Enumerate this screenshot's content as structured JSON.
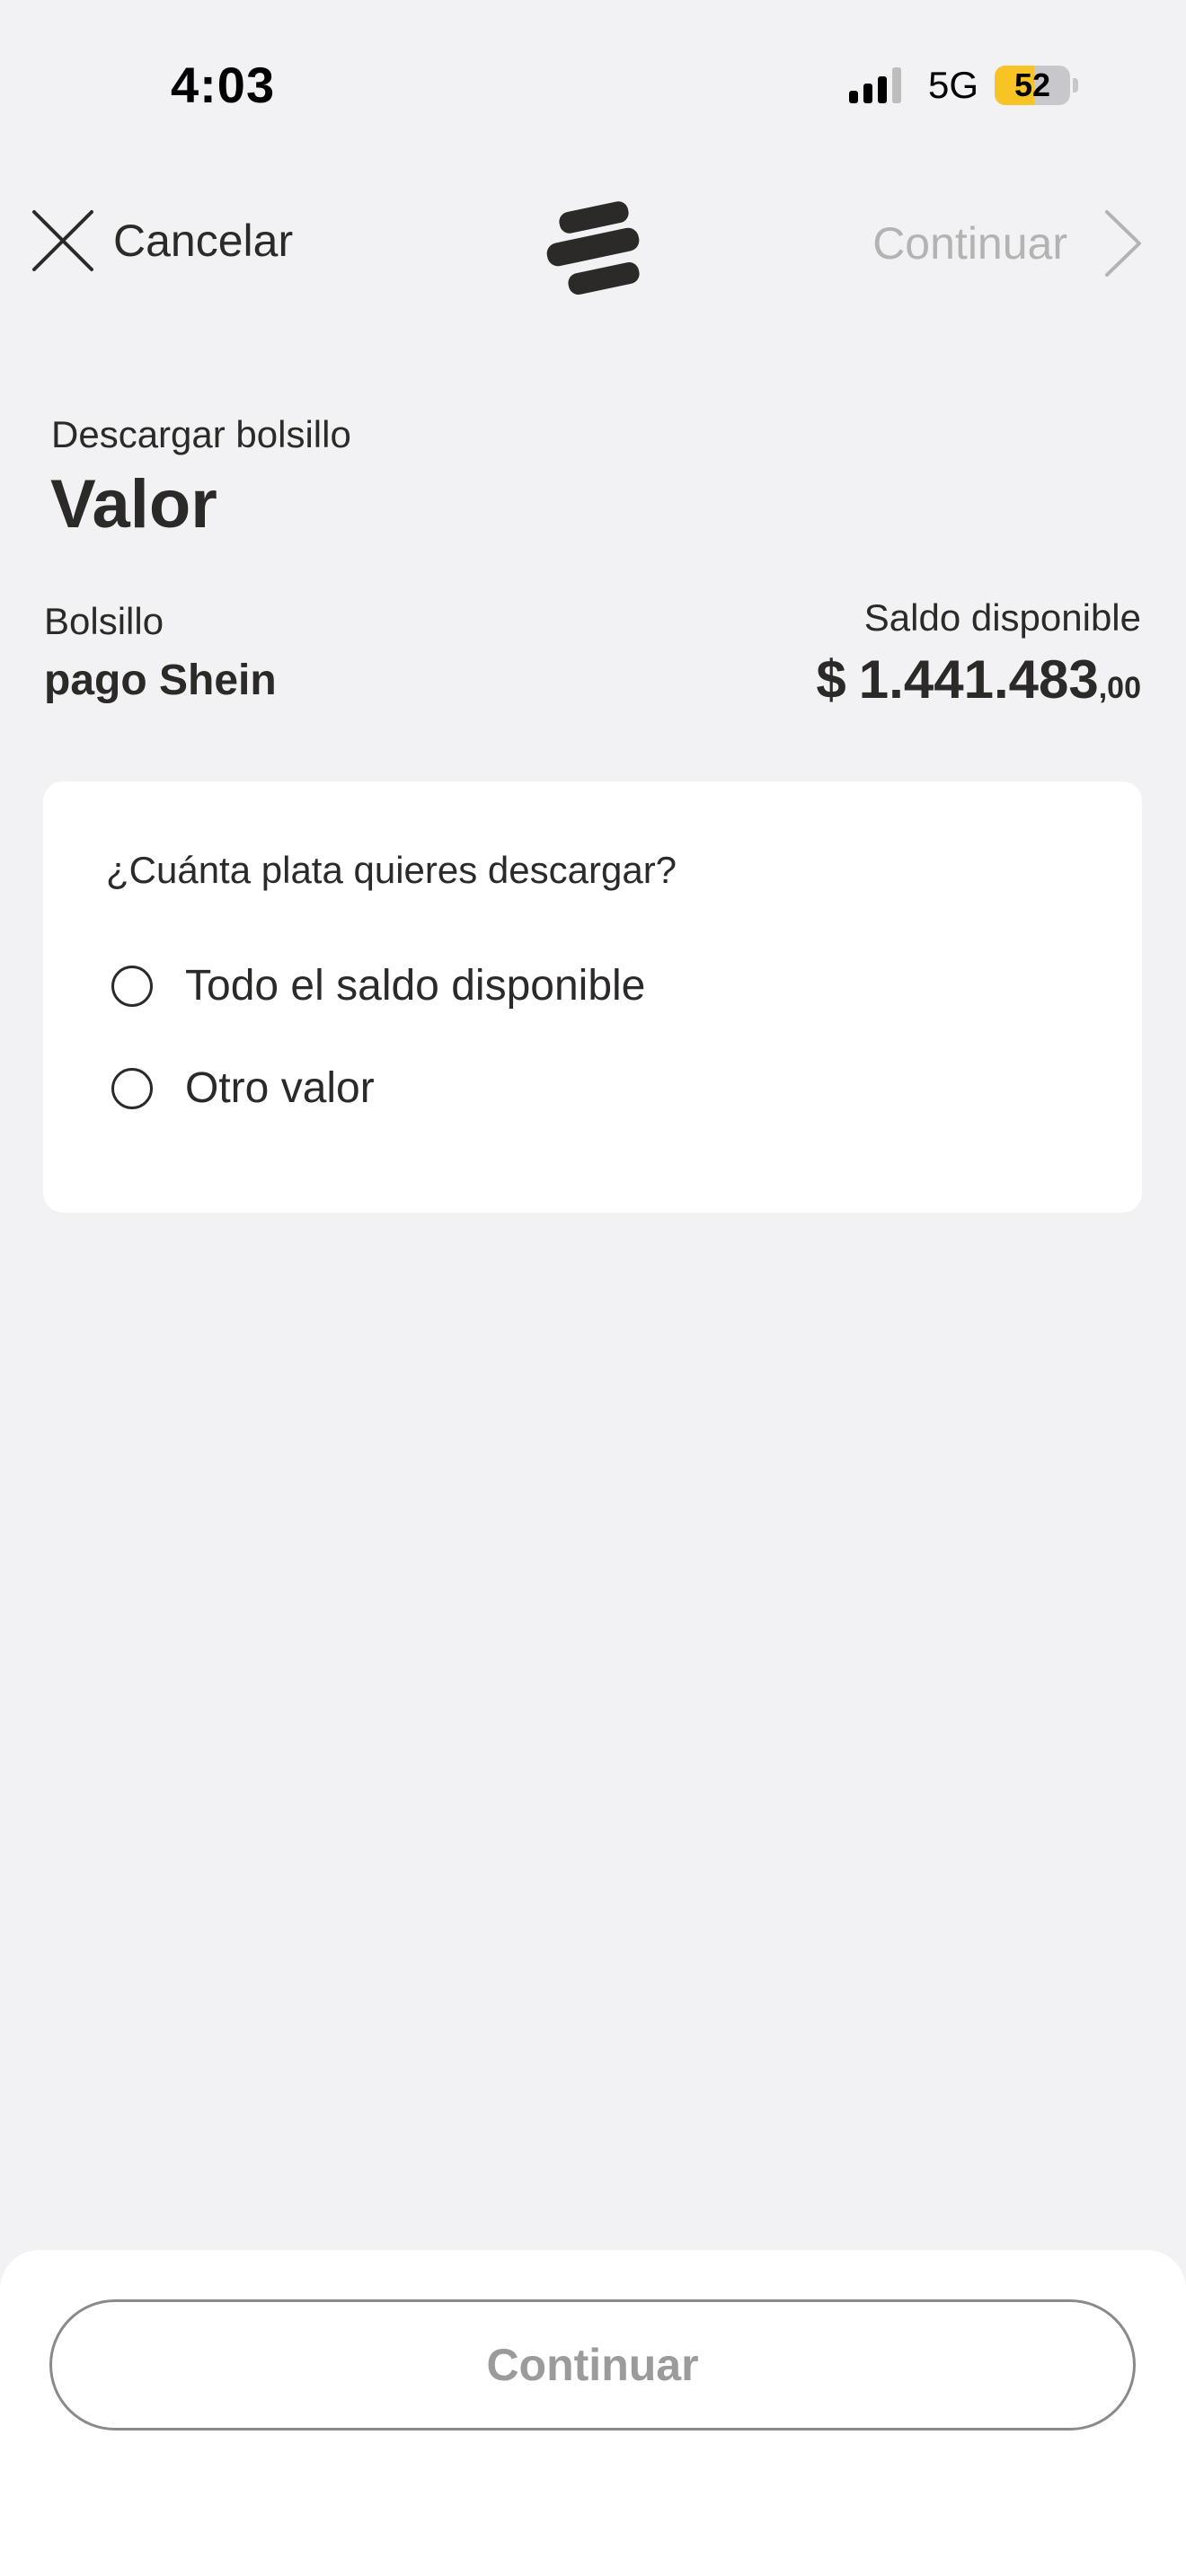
{
  "status_bar": {
    "time": "4:03",
    "network": "5G",
    "battery": "52",
    "battery_level": 0.52
  },
  "header": {
    "cancel_label": "Cancelar",
    "cancel_icon": "close-icon",
    "logo_icon": "bank-logo-icon",
    "next_label": "Continuar",
    "next_icon": "chevron-right-icon"
  },
  "page": {
    "subtitle": "Descargar bolsillo",
    "title": "Valor"
  },
  "pocket": {
    "label": "Bolsillo",
    "name": "pago Shein"
  },
  "balance": {
    "label": "Saldo disponible",
    "currency": "$",
    "integer": "1.441.483",
    "decimals": ",00"
  },
  "card": {
    "question": "¿Cuánta plata quieres descargar?",
    "options": [
      {
        "label": "Todo el saldo disponible",
        "selected": false
      },
      {
        "label": "Otro valor",
        "selected": false
      }
    ]
  },
  "footer": {
    "continue_label": "Continuar"
  },
  "colors": {
    "background": "#f2f2f4",
    "text": "#2c2a29",
    "disabled_text": "#b3b3b3",
    "battery": "#f7c325"
  }
}
